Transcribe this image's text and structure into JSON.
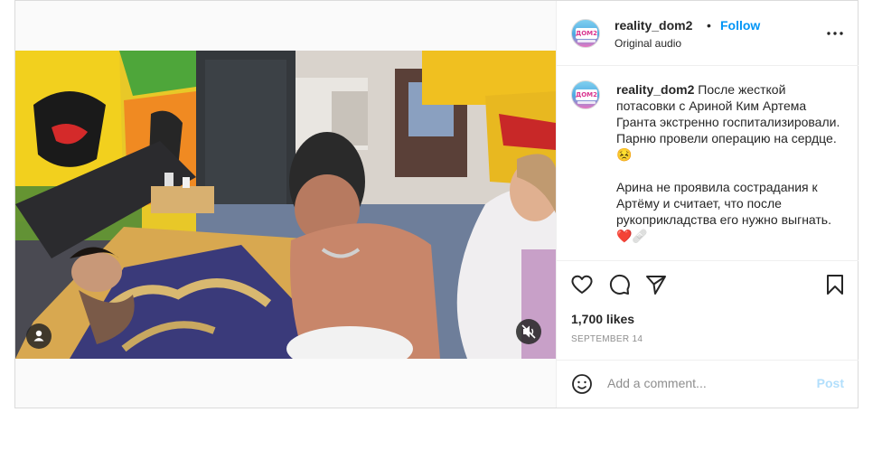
{
  "post": {
    "username": "reality_dom2",
    "follow_label": "Follow",
    "audio_label": "Original audio",
    "avatar_text": "ДОМ2",
    "caption_user": "reality_dom2",
    "caption_text": "После жесткой потасовки с Ариной Ким Артема Гранта экстренно госпитализировали. Парню провели операцию на сердце. 😣\n\nАрина не проявила сострадания к Артёму и считает, что после рукоприкладства его нужно выгнать. ❤️🩹",
    "likes": "1,700 likes",
    "date": "SEPTEMBER 14",
    "comment_placeholder": "Add a comment...",
    "post_label": "Post"
  },
  "icons": {
    "more": "more-options-icon",
    "like": "heart-icon",
    "comment": "comment-icon",
    "share": "share-icon",
    "save": "bookmark-icon",
    "emoji": "emoji-icon",
    "user_tag": "user-tag-icon",
    "mute": "muted-speaker-icon"
  },
  "colors": {
    "accent": "#0095f6",
    "post_disabled": "#b2dffc",
    "muted_text": "#8e8e8e",
    "border": "#dbdbdb"
  }
}
